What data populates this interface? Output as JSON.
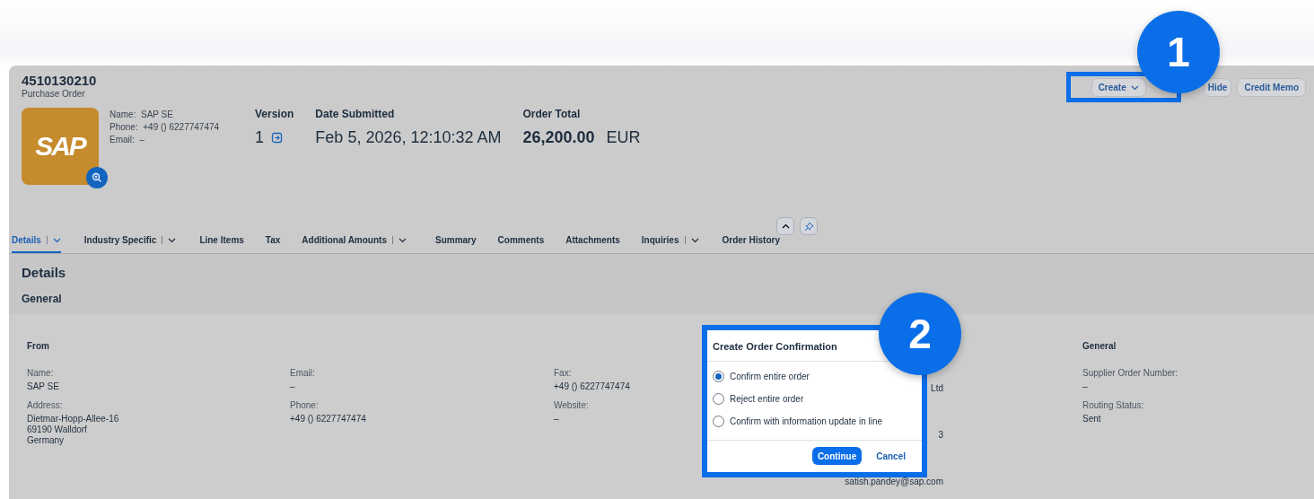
{
  "header": {
    "title": "4510130210",
    "subtitle": "Purchase Order",
    "actions": [
      {
        "label": "Create",
        "kind": "menu"
      },
      {
        "label": "Hide",
        "kind": "plain"
      },
      {
        "label": "Credit Memo",
        "kind": "plain"
      }
    ]
  },
  "supplier": {
    "logo_text": "SAP",
    "fields": [
      {
        "label": "Name:",
        "value": "SAP SE"
      },
      {
        "label": "Phone:",
        "value": "+49 () 6227747474"
      },
      {
        "label": "Email:",
        "value": "–"
      }
    ]
  },
  "summary": [
    {
      "label": "Version",
      "value": "1",
      "kind": "version"
    },
    {
      "label": "Date Submitted",
      "value": "Feb 5, 2026, 12:10:32 AM",
      "kind": "text"
    },
    {
      "label": "Order Total",
      "value": "26,200.00",
      "unit": "EUR",
      "kind": "amount"
    }
  ],
  "tabs": [
    {
      "label": "Details",
      "selected": true,
      "menu": true
    },
    {
      "label": "Industry Specific",
      "selected": false,
      "menu": true
    },
    {
      "label": "Line Items",
      "selected": false,
      "menu": false
    },
    {
      "label": "Tax",
      "selected": false,
      "menu": false
    },
    {
      "label": "Additional Amounts",
      "selected": false,
      "menu": true
    },
    {
      "label": "Summary",
      "selected": false,
      "menu": false
    },
    {
      "label": "Comments",
      "selected": false,
      "menu": false
    },
    {
      "label": "Attachments",
      "selected": false,
      "menu": false
    },
    {
      "label": "Inquiries",
      "selected": false,
      "menu": true
    },
    {
      "label": "Order History",
      "selected": false,
      "menu": false
    }
  ],
  "section": {
    "title": "Details",
    "subtitle": "General"
  },
  "from": {
    "title": "From",
    "columns": [
      [
        {
          "label": "Name:",
          "value": "SAP SE"
        },
        {
          "label": "Address:",
          "value": "Dietmar-Hopp-Allee-16\n69190 Walldorf\nGermany"
        }
      ],
      [
        {
          "label": "Email:",
          "value": "–"
        },
        {
          "label": "Phone:",
          "value": "+49 () 6227747474"
        }
      ],
      [
        {
          "label": "Fax:",
          "value": "+49 () 6227747474"
        },
        {
          "label": "Website:",
          "value": "–"
        }
      ]
    ]
  },
  "to_fragments": [
    "Ltd",
    "3",
    "satish.pandey@sap.com"
  ],
  "general": {
    "title": "General",
    "fields": [
      {
        "label": "Supplier Order Number:",
        "value": "–"
      },
      {
        "label": "Routing Status:",
        "value": "Sent"
      }
    ]
  },
  "dialog": {
    "title": "Create Order Confirmation",
    "options": [
      {
        "label": "Confirm entire order",
        "selected": true
      },
      {
        "label": "Reject entire order",
        "selected": false
      },
      {
        "label": "Confirm with information update in line",
        "selected": false
      }
    ],
    "buttons": [
      {
        "label": "Continue",
        "kind": "primary"
      },
      {
        "label": "Cancel",
        "kind": "plain"
      }
    ]
  },
  "callouts": [
    {
      "number": "1"
    },
    {
      "number": "2"
    }
  ]
}
